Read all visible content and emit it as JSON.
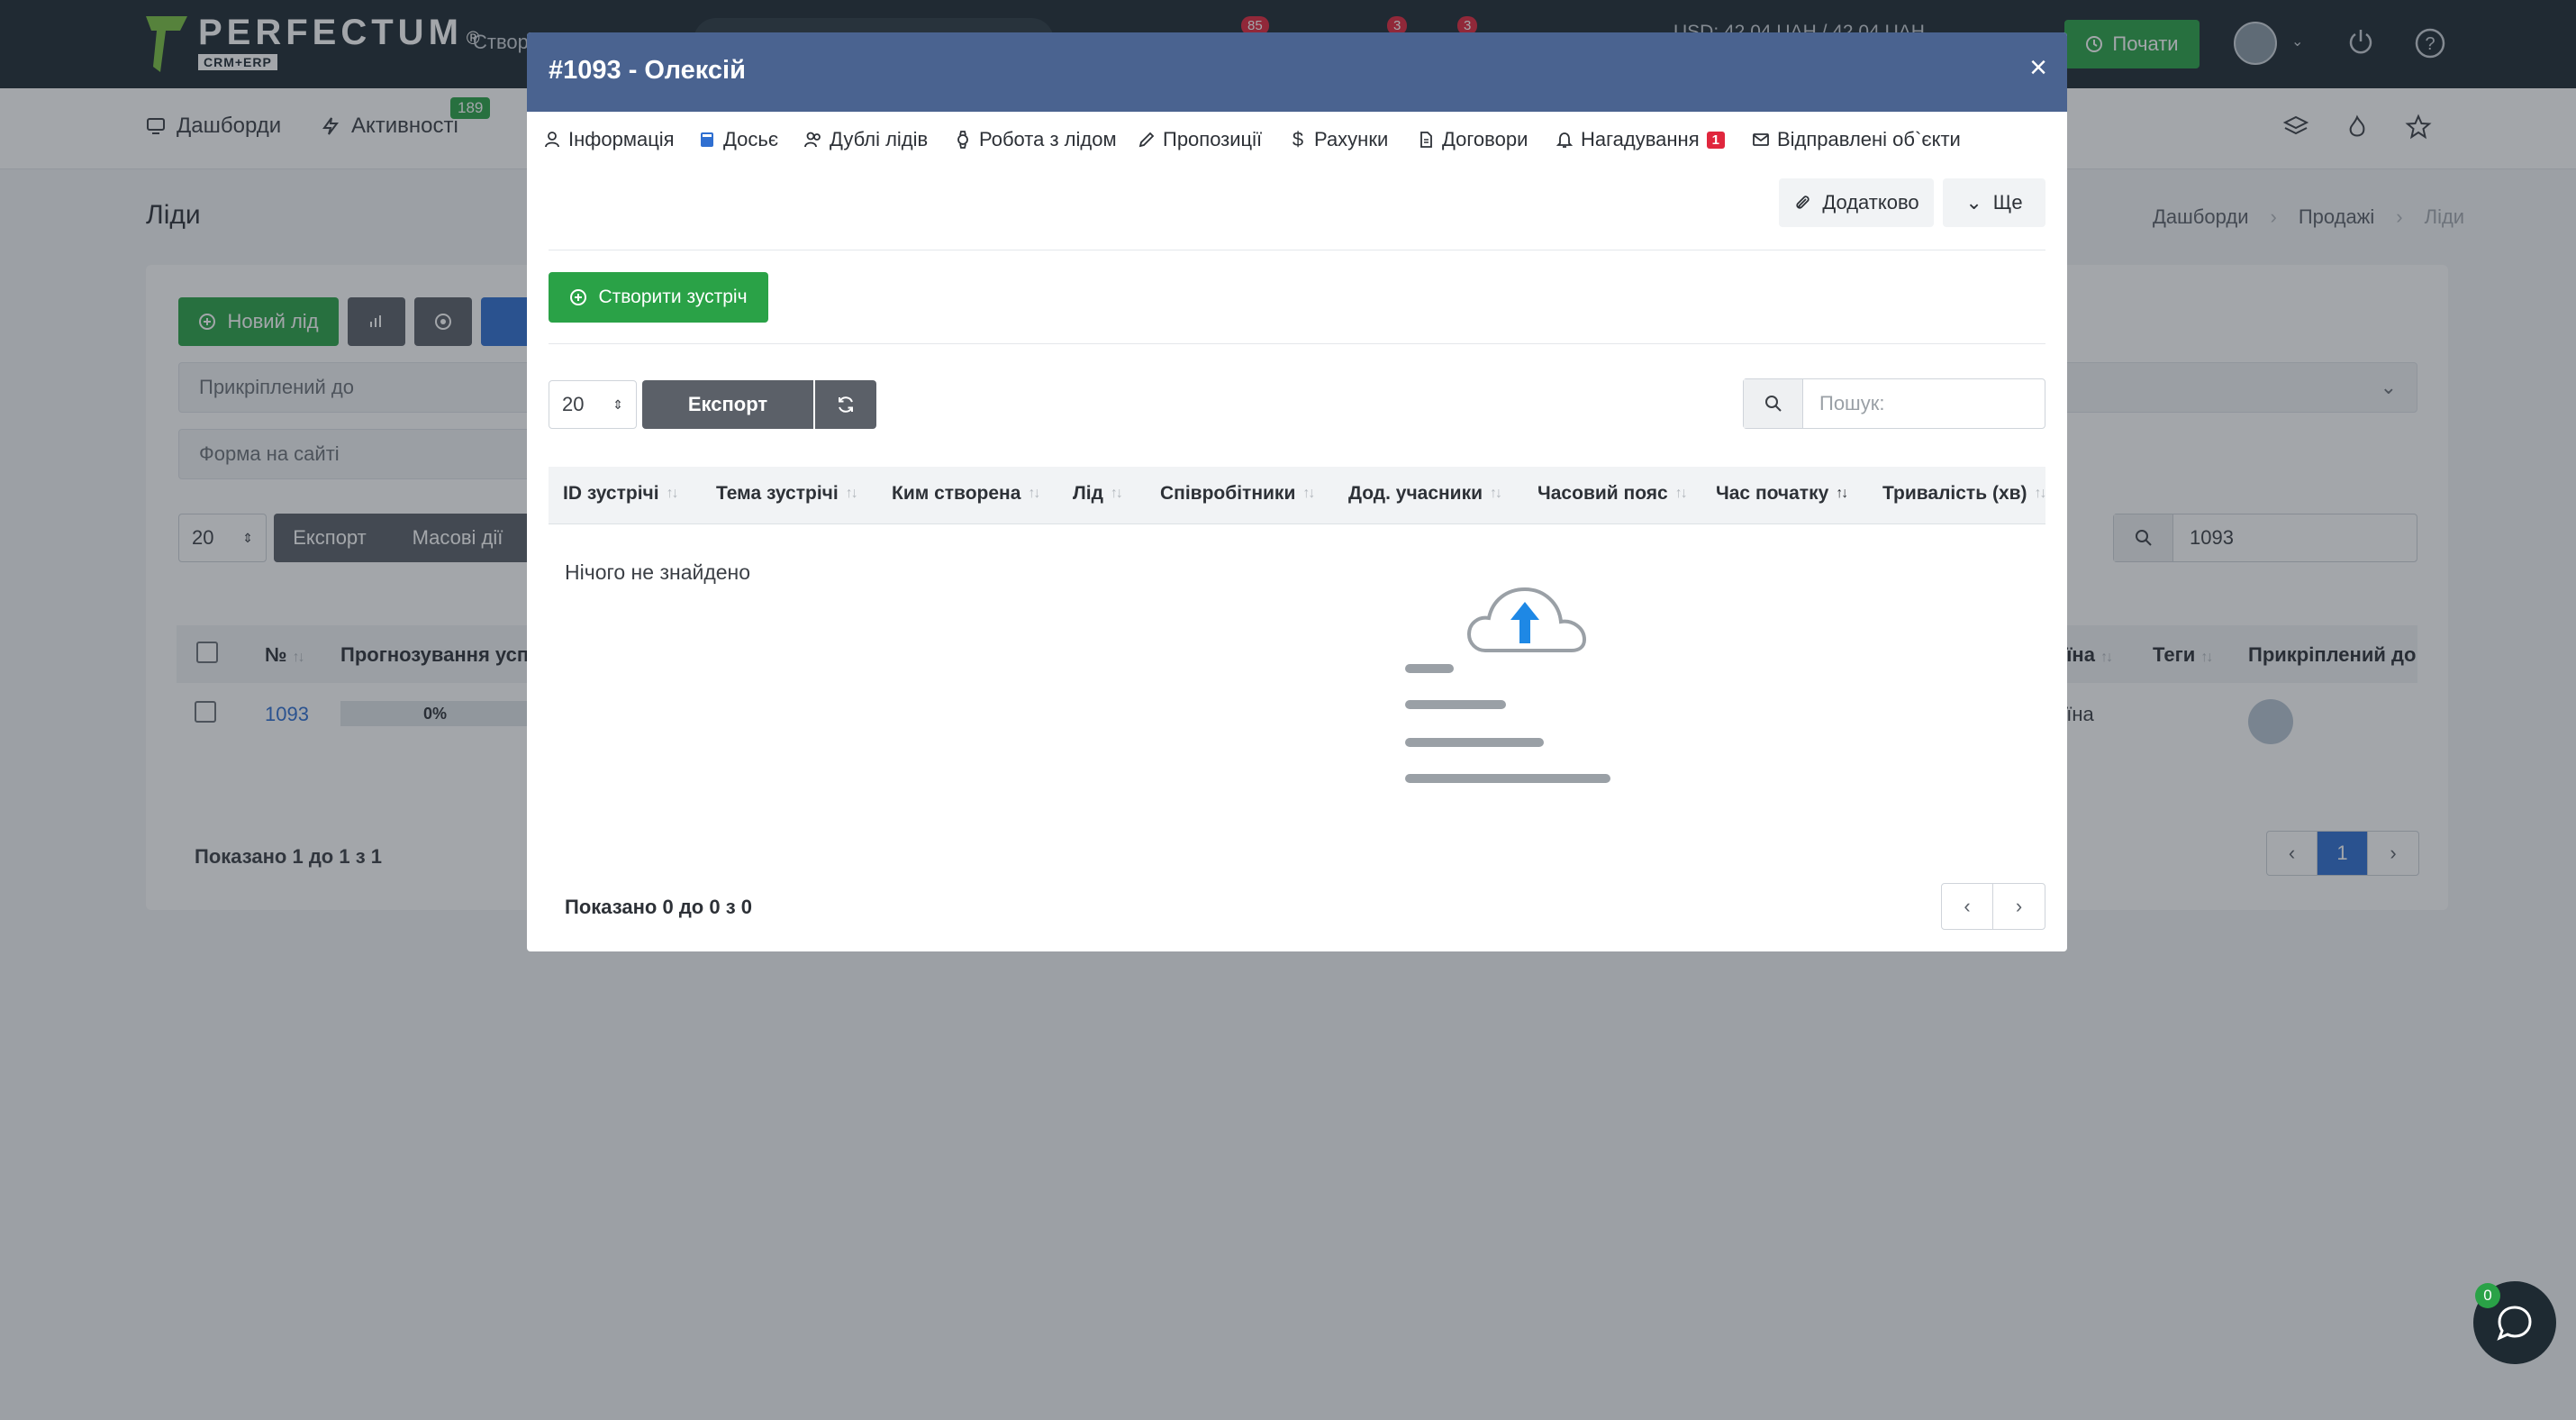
{
  "topbar": {
    "logo_text": "PERFECTUM",
    "logo_sub": "CRM+ERP",
    "logo_reg": "®",
    "create_label": "Створ",
    "badges": [
      "85",
      "3",
      "3"
    ],
    "currency": "USD: 42.04 UAH / 42.04 UAH",
    "start_label": "Почати"
  },
  "subnav": {
    "items": [
      {
        "label": "Дашборди",
        "icon": "monitor-icon"
      },
      {
        "label": "Активності",
        "icon": "bolt-icon"
      }
    ],
    "activities_badge": "189"
  },
  "page": {
    "title": "Ліди",
    "breadcrumb": [
      "Дашборди",
      "Продажі",
      "Ліди"
    ]
  },
  "card": {
    "new_lead_label": "Новий лід",
    "filter_attached": "Прикріплений до",
    "filter_form": "Форма на сайті",
    "per_page": "20",
    "export_label": "Експорт",
    "mass_actions_label": "Масові дії",
    "search_value": "1093",
    "columns": {
      "number": "№",
      "forecast": "Прогнозування успіх",
      "country": "аїна",
      "tags": "Теги",
      "attached": "Прикріплений до"
    },
    "row": {
      "id": "1093",
      "progress": "0%",
      "country": "аїна"
    },
    "shown_text": "Показано 1 до 1 з 1",
    "current_page": "1"
  },
  "modal": {
    "title": "#1093 - Олексій",
    "close": "×",
    "tabs": [
      {
        "label": "Інформація",
        "icon": "user-icon"
      },
      {
        "label": "Досьє",
        "icon": "book-icon"
      },
      {
        "label": "Дублі лідів",
        "icon": "users-icon"
      },
      {
        "label": "Робота з лідом",
        "icon": "watch-icon"
      },
      {
        "label": "Пропозиції",
        "icon": "pencil-icon"
      },
      {
        "label": "Рахунки",
        "icon": "dollar-icon"
      },
      {
        "label": "Договори",
        "icon": "document-icon"
      },
      {
        "label": "Нагадування",
        "icon": "bell-icon",
        "badge": "1"
      },
      {
        "label": "Відправлені об`єкти",
        "icon": "mail-icon"
      }
    ],
    "extra_label": "Додатково",
    "more_label": "Ще",
    "create_meeting_label": "Створити зустріч",
    "per_page": "20",
    "export_label": "Експорт",
    "search_placeholder": "Пошук:",
    "columns": [
      {
        "label": "ID зустрічі",
        "sorted": false
      },
      {
        "label": "Тема зустрічі",
        "sorted": false
      },
      {
        "label": "Ким створена",
        "sorted": false
      },
      {
        "label": "Лід",
        "sorted": false
      },
      {
        "label": "Співробітники",
        "sorted": false
      },
      {
        "label": "Дод. учасники",
        "sorted": false
      },
      {
        "label": "Часовий пояс",
        "sorted": false
      },
      {
        "label": "Час початку",
        "sorted": true
      },
      {
        "label": "Тривалість (хв)",
        "sorted": false
      }
    ],
    "empty_text": "Нічого не знайдено",
    "shown_text": "Показано 0 до 0 з 0"
  },
  "chat": {
    "badge": "0"
  },
  "colors": {
    "topbar": "#1e2a32",
    "modal_header": "#4a6390",
    "green": "#2aa247",
    "blue": "#2f6fd1",
    "red_badge": "#e0263d"
  }
}
